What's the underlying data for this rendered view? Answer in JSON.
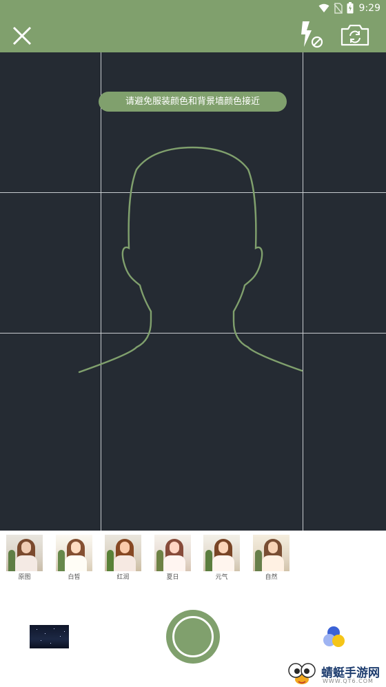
{
  "status_bar": {
    "time": "9:29"
  },
  "camera": {
    "tip": "请避免服装颜色和背景墙颜色接近",
    "accent_color": "#80a06d",
    "viewfinder_color": "#252b33"
  },
  "icons": {
    "close": "close-icon",
    "flash": "flash-off-icon",
    "switch": "switch-camera-icon",
    "beauty": "beauty-dots-icon"
  },
  "filters": [
    {
      "label": "原图"
    },
    {
      "label": "白皙"
    },
    {
      "label": "红润"
    },
    {
      "label": "夏日"
    },
    {
      "label": "元气"
    },
    {
      "label": "自然"
    }
  ],
  "watermark": {
    "title": "蜻蜓手游网",
    "url": "WWW.QT6.COM"
  }
}
